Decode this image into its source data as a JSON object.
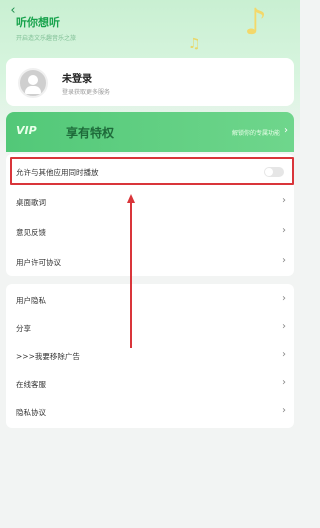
{
  "header": {
    "title": "听你想听",
    "subtitle": "开启造文乐趣音乐之旅",
    "back_icon": "back-icon"
  },
  "login": {
    "title": "未登录",
    "subtitle": "登录获取更多服务"
  },
  "vip": {
    "logo": "VIP",
    "title": "享有特权",
    "link": "解锁你的专属功能"
  },
  "settings_group_1": [
    {
      "label": "允许与其他应用同时播放",
      "type": "toggle",
      "enabled": false
    },
    {
      "label": "桌面歌词",
      "type": "link"
    },
    {
      "label": "意见反馈",
      "type": "link"
    },
    {
      "label": "用户许可协议",
      "type": "link"
    }
  ],
  "settings_group_2": [
    {
      "label": "用户隐私",
      "type": "link"
    },
    {
      "label": "分享",
      "type": "link"
    },
    {
      "label": ">>>我要移除广告",
      "type": "link"
    },
    {
      "label": "在线客服",
      "type": "link"
    },
    {
      "label": "隐私协议",
      "type": "link"
    }
  ],
  "colors": {
    "accent_green": "#52c878",
    "highlight_red": "#d9353a"
  }
}
